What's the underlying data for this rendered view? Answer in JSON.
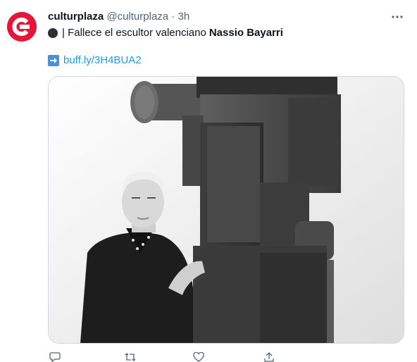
{
  "tweet": {
    "display_name": "culturplaza",
    "handle": "@culturplaza",
    "separator": "·",
    "time": "3h",
    "text_prefix": "| Fallece el escultor valenciano",
    "text_bold": "Nassio Bayarri",
    "link": "buff.ly/3H4BUA2",
    "reply_count": "",
    "retweet_count": "",
    "like_count": ""
  },
  "icons": {
    "avatar": "culturplaza-logo",
    "more": "more-icon",
    "circle": "black-circle-icon",
    "arrow": "right-arrow-icon",
    "reply": "reply-icon",
    "retweet": "retweet-icon",
    "like": "heart-icon",
    "share": "share-icon"
  },
  "colors": {
    "brand": "#e5163a",
    "link": "#1d9bf0",
    "muted": "#536471"
  }
}
